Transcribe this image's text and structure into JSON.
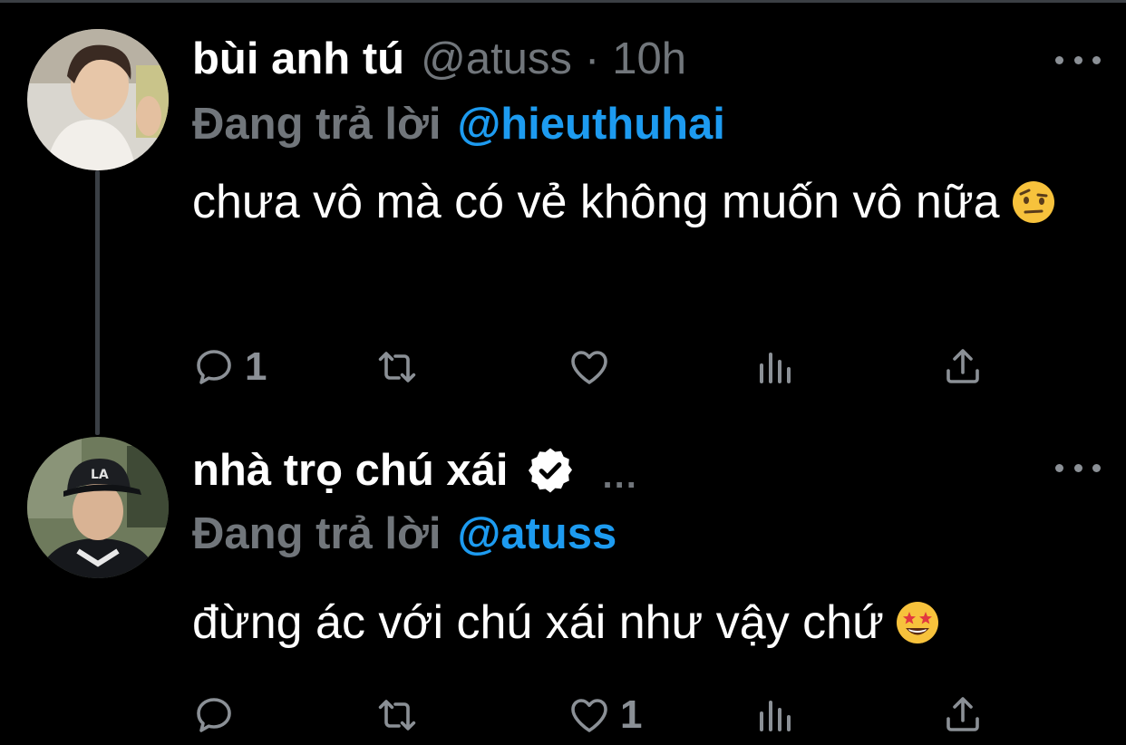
{
  "tweets": [
    {
      "display_name": "bùi anh tú",
      "handle": "@atuss",
      "separator": "·",
      "time": "10h",
      "reply_prefix": "Đang trả lời",
      "reply_to": "@hieuthuhai",
      "text": "chưa vô mà có vẻ không muốn vô nữa",
      "emoji": "face-with-raised-eyebrow",
      "actions": {
        "reply_count": "1",
        "retweet_count": "",
        "like_count": "",
        "views_count": ""
      },
      "more_icon": "more-horizontal-icon"
    },
    {
      "display_name": "nhà trọ chú xái",
      "verified": true,
      "inline_more": "...",
      "reply_prefix": "Đang trả lời",
      "reply_to": "@atuss",
      "text": "đừng ác với chú xái như vậy chứ",
      "emoji": "star-struck",
      "actions": {
        "reply_count": "",
        "retweet_count": "",
        "like_count": "1",
        "views_count": ""
      },
      "more_icon": "more-horizontal-icon"
    }
  ],
  "colors": {
    "background": "#000000",
    "text": "#ffffff",
    "muted": "#71767b",
    "link": "#1d9bf0",
    "thread_line": "#3a3f45"
  }
}
